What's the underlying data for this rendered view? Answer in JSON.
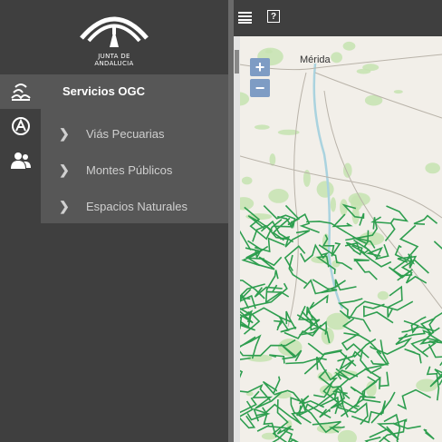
{
  "brand": {
    "logo_text": "JUNTA DE ANDALUCIA"
  },
  "sidebar": {
    "icons": [
      {
        "name": "servicios-ogc-icon",
        "active": true
      },
      {
        "name": "compass-icon",
        "active": false
      },
      {
        "name": "users-icon",
        "active": false
      }
    ],
    "panel_title": "Servicios OGC",
    "items": [
      {
        "label": "Viás Pecuarias"
      },
      {
        "label": "Montes Públicos"
      },
      {
        "label": "Espacios Naturales"
      }
    ]
  },
  "toolbar": {
    "list_icon": "list-icon",
    "help_icon": "help-icon",
    "help_label": "?"
  },
  "map": {
    "zoom_in": "+",
    "zoom_out": "−",
    "city_label": "Mérida",
    "colors": {
      "route": "#2e9e4f",
      "forest": "#c5e3b0",
      "water": "#aad3df",
      "road": "#b9b3a9"
    }
  }
}
